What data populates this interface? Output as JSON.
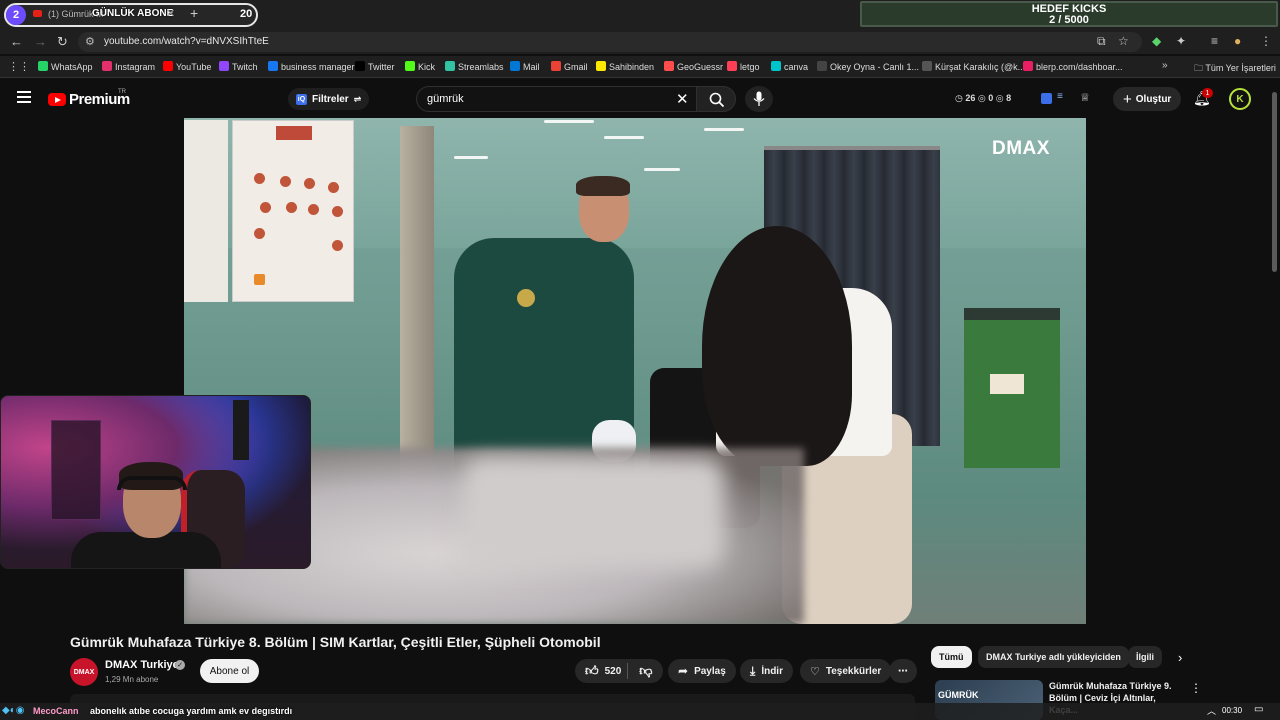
{
  "overlay": {
    "sub_goal_badge": "2",
    "sub_goal_label": "GÜNLÜK ABONE",
    "sub_goal_count": "20",
    "kicks_goal_title": "HEDEF KICKS",
    "kicks_goal_progress": "2 / 5000"
  },
  "browser": {
    "tab_title": "(1) Gümrük M",
    "tab_close": "✕",
    "new_tab": "+",
    "url": "youtube.com/watch?v=dNVXSIhTteE",
    "bookmarks": [
      {
        "label": "WhatsApp",
        "color": "#25d366"
      },
      {
        "label": "Instagram",
        "color": "#e1306c"
      },
      {
        "label": "YouTube",
        "color": "#ff0000"
      },
      {
        "label": "Twitch",
        "color": "#9146ff"
      },
      {
        "label": "business manager",
        "color": "#1877f2"
      },
      {
        "label": "Twitter",
        "color": "#000000"
      },
      {
        "label": "Kick",
        "color": "#53fc18"
      },
      {
        "label": "Streamlabs",
        "color": "#31c3a2"
      },
      {
        "label": "Mail",
        "color": "#0078d4"
      },
      {
        "label": "Gmail",
        "color": "#ea4335"
      },
      {
        "label": "Sahibinden",
        "color": "#ffe800"
      },
      {
        "label": "GeoGuessr",
        "color": "#ff4d4d"
      },
      {
        "label": "letgo",
        "color": "#ff3f55"
      },
      {
        "label": "canva",
        "color": "#00c4cc"
      },
      {
        "label": "Okey Oyna - Canlı 1...",
        "color": "#444444"
      },
      {
        "label": "Kürşat Karakılıç (@k...",
        "color": "#555555"
      },
      {
        "label": "blerp.com/dashboar...",
        "color": "#e91e63"
      }
    ],
    "all_bookmarks": "Tüm Yer İşaretleri"
  },
  "youtube": {
    "logo_text": "Premium",
    "country": "TR",
    "filters_label": "Filtreler",
    "search_value": "gümrük",
    "stats": "◷ 26  ◎ 0  ◎ 8",
    "create_label": "Oluştur",
    "notif_count": "1",
    "avatar_letter": "K"
  },
  "video": {
    "brand_watermark": "DMAX",
    "title": "Gümrük Muhafaza Türkiye 8. Bölüm | SIM Kartlar, Çeşitli Etler, Şüpheli Otomobil",
    "channel_avatar": "DMAX",
    "channel_name": "DMAX Turkiye",
    "subscribers": "1,29 Mn abone",
    "subscribe_label": "Abone ol",
    "likes": "520",
    "share_label": "Paylaş",
    "download_label": "İndir",
    "thanks_label": "Teşekkürler",
    "more_label": "⋯"
  },
  "sidebar": {
    "chips": [
      "Tümü",
      "DMAX Turkiye adlı yükleyiciden",
      "İlgili"
    ],
    "next": "›",
    "rec_thumb_label": "GÜMRÜK",
    "rec_title": "Gümrük Muhafaza Türkiye 9. Bölüm | Ceviz İçi Altınlar, Kaça..."
  },
  "chat": {
    "user": "MecoCann",
    "message": "abonelık atıbe cocuga yardım amk ev degıstırdı"
  },
  "taskbar": {
    "time": "00:30"
  }
}
